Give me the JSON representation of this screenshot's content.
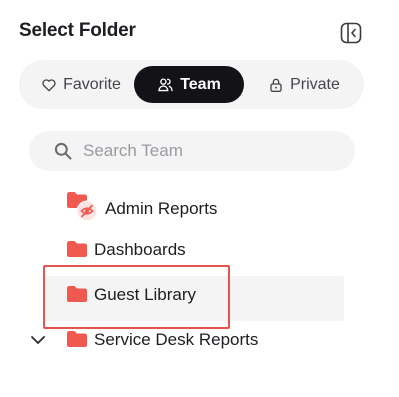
{
  "header": {
    "title": "Select Folder",
    "collapse_icon": "sidebar-collapse-icon"
  },
  "tabs": [
    {
      "label": "Favorite",
      "icon": "heart-icon",
      "active": false
    },
    {
      "label": "Team",
      "icon": "users-icon",
      "active": true
    },
    {
      "label": "Private",
      "icon": "lock-icon",
      "active": false
    }
  ],
  "search": {
    "placeholder": "Search Team",
    "value": ""
  },
  "tree": {
    "items": [
      {
        "label": "Admin Reports",
        "icon": "folder-hidden-icon"
      },
      {
        "label": "Dashboards",
        "icon": "folder-icon"
      },
      {
        "label": "Guest Library",
        "icon": "folder-icon",
        "selected": true
      },
      {
        "label": "Service Desk Reports",
        "icon": "folder-icon",
        "expandable": true
      }
    ]
  },
  "colors": {
    "accent": "#f0594f",
    "active_tab": "#121217",
    "surface": "#f4f4f5",
    "highlight_border": "#e4554d"
  }
}
